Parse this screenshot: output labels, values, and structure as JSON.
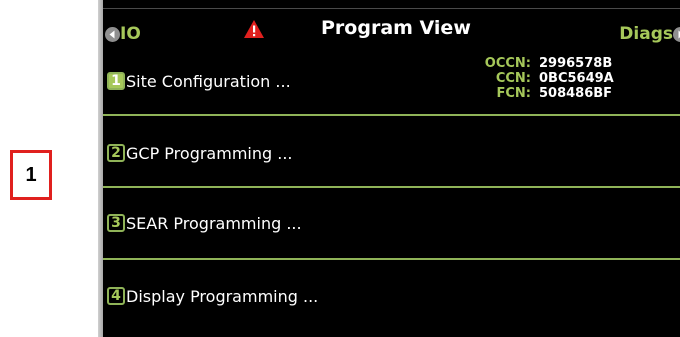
{
  "callout": {
    "label": "1"
  },
  "header": {
    "left_nav_label": "IO",
    "title": "Program View",
    "right_nav_label": "Diags",
    "icons": {
      "left": "chevron-left-icon",
      "warning": "warning-triangle-icon",
      "right": "chevron-right-icon"
    }
  },
  "crc": {
    "occn_label": "OCCN:",
    "occn_value": "2996578B",
    "ccn_label": "CCN:",
    "ccn_value": "0BC5649A",
    "fcn_label": "FCN:",
    "fcn_value": "508486BF"
  },
  "menu": {
    "items": [
      {
        "number": "1",
        "label": "Site Configuration ..."
      },
      {
        "number": "2",
        "label": "GCP Programming ..."
      },
      {
        "number": "3",
        "label": "SEAR Programming ..."
      },
      {
        "number": "4",
        "label": "Display Programming ..."
      }
    ]
  },
  "colors": {
    "accent_green": "#a6c85a",
    "warning_red": "#e0201e",
    "screen_bg": "#000000"
  }
}
